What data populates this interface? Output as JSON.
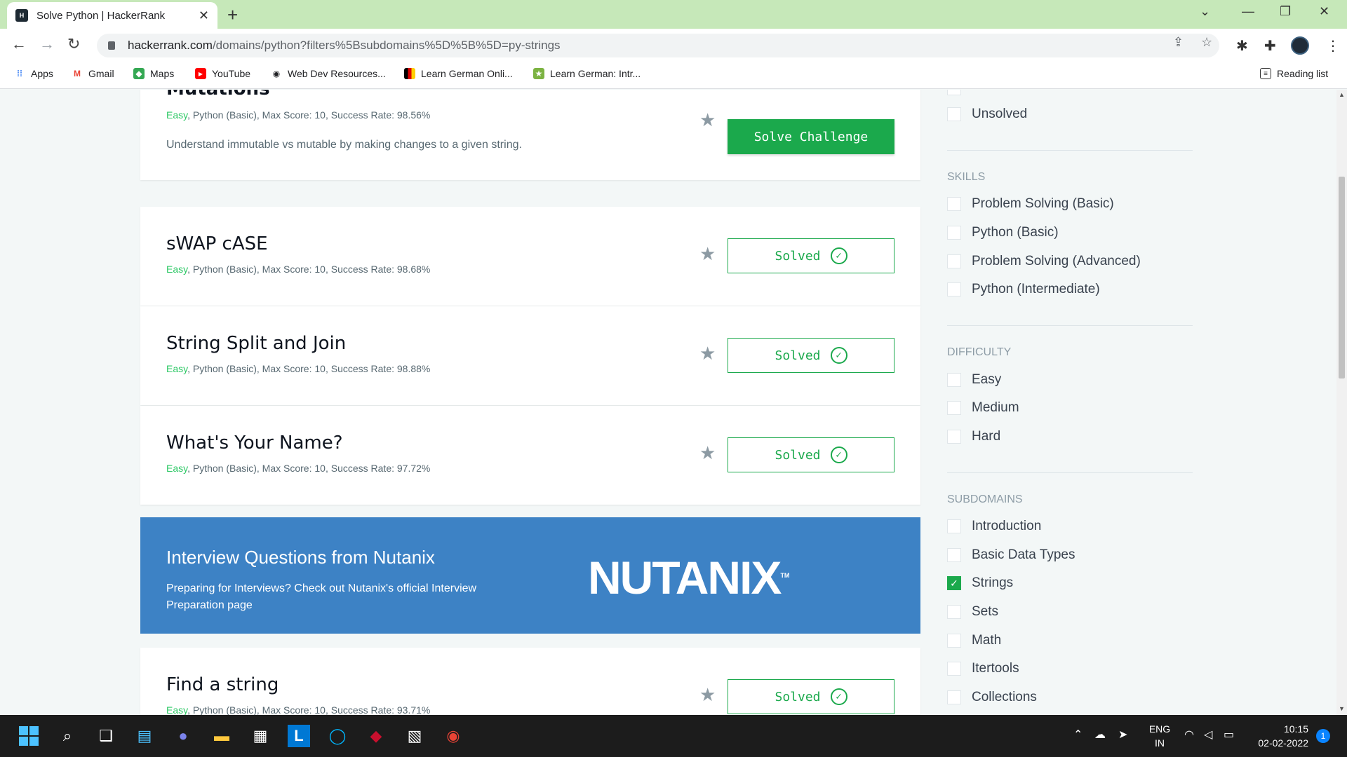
{
  "browser": {
    "tab_title": "Solve Python | HackerRank",
    "tab_favicon_text": "H",
    "url_host": "hackerrank.com",
    "url_path": "/domains/python?filters%5Bsubdomains%5D%5B%5D=py-strings",
    "reading_list": "Reading list",
    "bookmarks": [
      {
        "label": "Apps",
        "icon": "apps-grid-icon",
        "color": "#4285f4"
      },
      {
        "label": "Gmail",
        "icon": "gmail-icon",
        "color": "#ea4335"
      },
      {
        "label": "Maps",
        "icon": "maps-icon",
        "color": "#34a853"
      },
      {
        "label": "YouTube",
        "icon": "youtube-icon",
        "color": "#ff0000"
      },
      {
        "label": "Web Dev Resources...",
        "icon": "globe-icon",
        "color": "#202124"
      },
      {
        "label": "Learn German Onli...",
        "icon": "german-flag-icon",
        "color": "#f4b400"
      },
      {
        "label": "Learn German: Intr...",
        "icon": "star-bookmark-icon",
        "color": "#7cb342"
      }
    ]
  },
  "challenges": [
    {
      "name": "Mutations",
      "difficulty": "Easy",
      "meta": ", Python (Basic), Max Score: 10, Success Rate: 98.56%",
      "description": "Understand immutable vs mutable by making changes to a given string.",
      "action": "Solve Challenge",
      "solved": false
    },
    {
      "name": "sWAP cASE",
      "difficulty": "Easy",
      "meta": ", Python (Basic), Max Score: 10, Success Rate: 98.68%",
      "action": "Solved",
      "solved": true
    },
    {
      "name": "String Split and Join",
      "difficulty": "Easy",
      "meta": ", Python (Basic), Max Score: 10, Success Rate: 98.88%",
      "action": "Solved",
      "solved": true
    },
    {
      "name": "What's Your Name?",
      "difficulty": "Easy",
      "meta": ", Python (Basic), Max Score: 10, Success Rate: 97.72%",
      "action": "Solved",
      "solved": true
    },
    {
      "name": "Find a string",
      "difficulty": "Easy",
      "meta": ", Python (Basic), Max Score: 10, Success Rate: 93.71%",
      "action": "Solved",
      "solved": true
    }
  ],
  "promo": {
    "title": "Interview Questions from Nutanix",
    "text": "Preparing for Interviews? Check out Nutanix's official Interview Preparation page",
    "logo": "NUTANIX",
    "logo_tm": "TM"
  },
  "sidebar": {
    "status_items": [
      {
        "label": "Unsolved",
        "checked": false
      }
    ],
    "skills_label": "SKILLS",
    "skills": [
      {
        "label": "Problem Solving (Basic)",
        "checked": false
      },
      {
        "label": "Python (Basic)",
        "checked": false
      },
      {
        "label": "Problem Solving (Advanced)",
        "checked": false
      },
      {
        "label": "Python (Intermediate)",
        "checked": false
      }
    ],
    "difficulty_label": "DIFFICULTY",
    "difficulty": [
      {
        "label": "Easy",
        "checked": false
      },
      {
        "label": "Medium",
        "checked": false
      },
      {
        "label": "Hard",
        "checked": false
      }
    ],
    "subdomains_label": "SUBDOMAINS",
    "subdomains": [
      {
        "label": "Introduction",
        "checked": false
      },
      {
        "label": "Basic Data Types",
        "checked": false
      },
      {
        "label": "Strings",
        "checked": true
      },
      {
        "label": "Sets",
        "checked": false
      },
      {
        "label": "Math",
        "checked": false
      },
      {
        "label": "Itertools",
        "checked": false
      },
      {
        "label": "Collections",
        "checked": false
      }
    ]
  },
  "taskbar": {
    "lang_top": "ENG",
    "lang_bottom": "IN",
    "time": "10:15",
    "date": "02-02-2022",
    "notification_count": "1"
  },
  "colors": {
    "accent_green": "#1ba94c",
    "promo_blue": "#3d82c5",
    "tab_strip": "#c6e8b9"
  }
}
